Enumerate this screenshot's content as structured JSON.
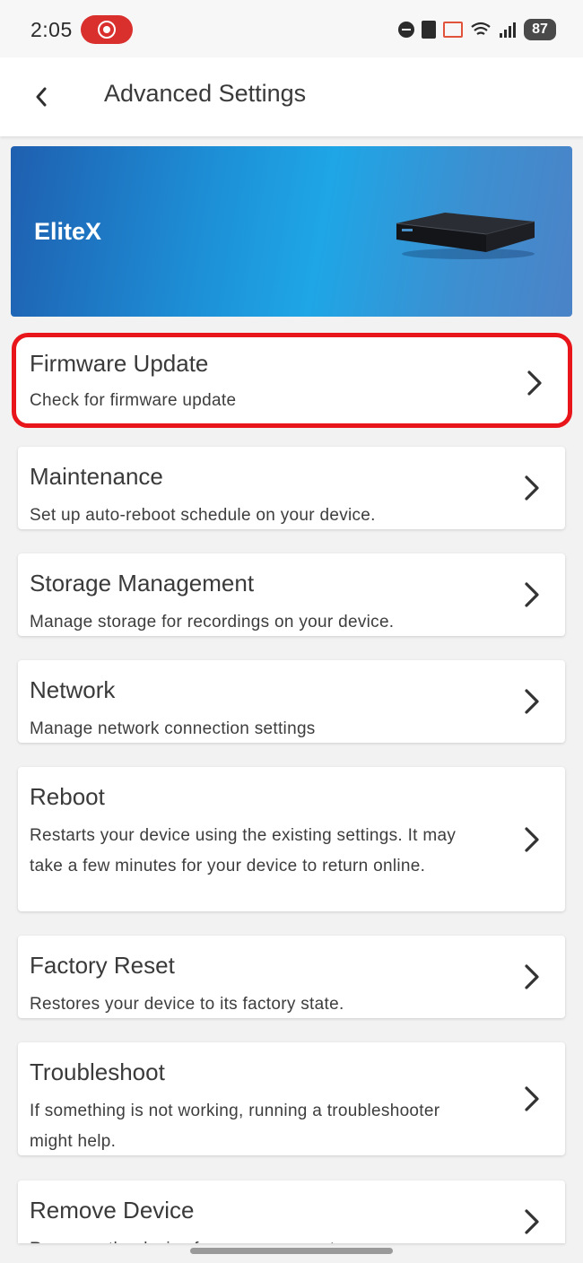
{
  "status_bar": {
    "time": "2:05",
    "battery": "87"
  },
  "app_bar": {
    "title": "Advanced Settings"
  },
  "device": {
    "name": "EliteX"
  },
  "menu": [
    {
      "title": "Firmware Update",
      "description": "Check for firmware update",
      "highlighted": true
    },
    {
      "title": "Maintenance",
      "description": "Set up auto-reboot schedule on your device."
    },
    {
      "title": "Storage Management",
      "description": "Manage storage for recordings on your device."
    },
    {
      "title": "Network",
      "description": "Manage network connection settings"
    },
    {
      "title": "Reboot",
      "description": "Restarts your device using the existing settings. It may take a few minutes for your device to return online."
    },
    {
      "title": "Factory Reset",
      "description": "Restores your device to its factory state."
    },
    {
      "title": "Troubleshoot",
      "description": "If something is not working, running a troubleshooter might help."
    },
    {
      "title": "Remove Device",
      "description": "Removes the device from your account."
    }
  ],
  "colors": {
    "highlight_border": "#e8161a",
    "banner_start": "#1f5fb0",
    "banner_mid": "#1ea6e6",
    "record_pill": "#d9302e"
  }
}
